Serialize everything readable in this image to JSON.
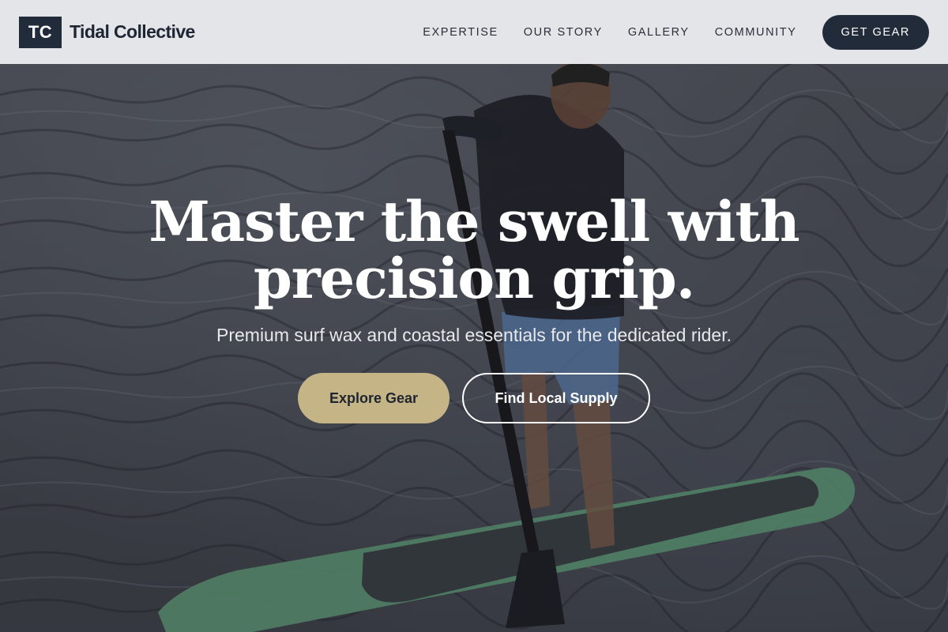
{
  "brand": {
    "mark": "TC",
    "name": "Tidal Collective"
  },
  "nav": {
    "links": [
      "EXPERTISE",
      "OUR STORY",
      "GALLERY",
      "COMMUNITY"
    ],
    "cta": "GET GEAR"
  },
  "hero": {
    "headline_line1": "Master the swell with",
    "headline_line2": "precision grip.",
    "subhead": "Premium surf wax and coastal essentials for the dedicated rider.",
    "primary_button": "Explore Gear",
    "secondary_button": "Find Local Supply",
    "image_subject": "paddleboarder-on-ocean"
  },
  "colors": {
    "navy": "#222b3a",
    "sand": "#c4b486",
    "header_bg": "#eaebee",
    "board_green": "#6fb58a"
  }
}
